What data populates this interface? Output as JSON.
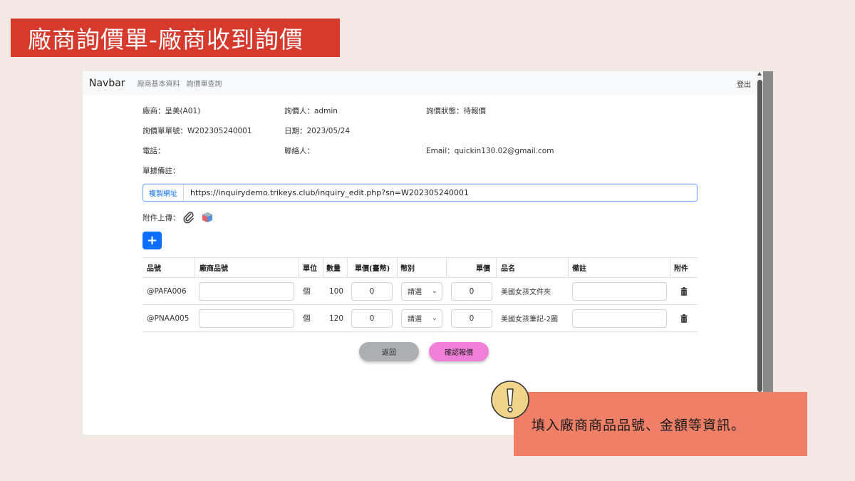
{
  "slide": {
    "title": "廠商詢價單-廠商收到詢價",
    "callout": "填入廠商商品品號、金額等資訊。"
  },
  "navbar": {
    "brand": "Navbar",
    "links": [
      "廠商基本資料",
      "詢價單查詢"
    ],
    "logout": "登出"
  },
  "info": {
    "vendor": "廠商：呈美(A01)",
    "inquirer": "詢價人：admin",
    "status": "詢價狀態：待報價",
    "number": "詢價單單號：W202305240001",
    "date": "日期：2023/05/24",
    "phone": "電話：",
    "contact": "聯絡人：",
    "email": "Email：quickin130.02@gmail.com",
    "note": "單據備註："
  },
  "url_group": {
    "copy_label": "複製網址",
    "url": "https://inquirydemo.trikeys.club/inquiry_edit.php?sn=W202305240001"
  },
  "attach_label": "附件上傳：",
  "add_button": "+",
  "table": {
    "headers": [
      "品號",
      "廠商品號",
      "單位",
      "數量",
      "單價(臺幣)",
      "幣別",
      "單價",
      "品名",
      "備註",
      "附件"
    ],
    "rows": [
      {
        "code": "@PAFA006",
        "vendor_code": "",
        "unit": "個",
        "qty": "100",
        "price_twd": "0",
        "currency": "請選",
        "price": "0",
        "name": "美國女孩文件夾",
        "remark": ""
      },
      {
        "code": "@PNAA005",
        "vendor_code": "",
        "unit": "個",
        "qty": "120",
        "price_twd": "0",
        "currency": "請選",
        "price": "0",
        "name": "美國女孩筆記-2圖",
        "remark": ""
      }
    ]
  },
  "buttons": {
    "back": "返回",
    "confirm": "確認報價"
  },
  "colors": {
    "title_bg": "#d63a2c",
    "callout_bg": "#ef7f66",
    "primary": "#0d6efd",
    "confirm_bg": "#f07fd8",
    "back_bg": "#adb0b3",
    "page_bg": "#f2e8e4"
  }
}
